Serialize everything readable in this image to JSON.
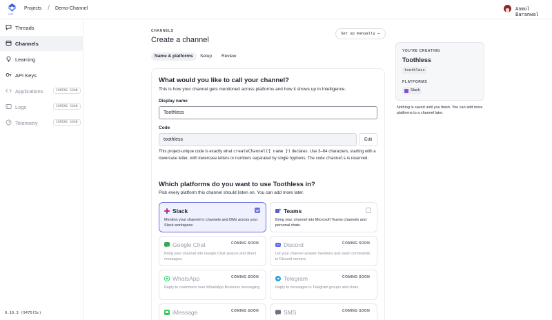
{
  "topbar": {
    "breadcrumbs": [
      "Projects",
      "Demo-Channel"
    ],
    "separator": "/",
    "user_name": "Anmol Baranwal"
  },
  "sidebar": {
    "items": [
      {
        "label": "Threads",
        "icon": "chat-bubble-icon",
        "state": "normal"
      },
      {
        "label": "Channels",
        "icon": "channels-icon",
        "state": "active"
      },
      {
        "label": "Learning",
        "icon": "lightbulb-icon",
        "state": "normal"
      },
      {
        "label": "API Keys",
        "icon": "key-icon",
        "state": "normal"
      },
      {
        "label": "Applications",
        "icon": "code-icon",
        "state": "soon",
        "badge": "COMING SOON"
      },
      {
        "label": "Logs",
        "icon": "terminal-icon",
        "state": "soon",
        "badge": "COMING SOON"
      },
      {
        "label": "Telemetry",
        "icon": "telemetry-icon",
        "state": "soon",
        "badge": "COMING SOON"
      }
    ],
    "version": "0.10.3 (9475f3c)"
  },
  "header": {
    "eyebrow": "CHANNELS",
    "title": "Create a channel",
    "manual_button": "Set up manually →",
    "tabs": [
      "Name & platforms",
      "Setup",
      "Review"
    ],
    "active_tab": "Name & platforms"
  },
  "form": {
    "title": "What would you like to call your channel?",
    "subtitle": "This is how your channel gets mentioned across platforms and how it shows up in Intelligence.",
    "display_name_label": "Display name",
    "display_name_value": "Toothless",
    "code_label": "Code",
    "code_value": "toothless",
    "edit_button": "Edit",
    "help_part1": "This project-unique code is exactly what ",
    "help_code1": "createChannel({ name })",
    "help_part2": " declares. Use 3–64 characters, starting with a lowercase letter, with lowercase letters or numbers separated by single hyphens. The code ",
    "help_code2": "channels",
    "help_part3": " is reserved."
  },
  "platforms_section": {
    "title": "Which platforms do you want to use Toothless in?",
    "subtitle": "Pick every platform this channel should listen on. You can add more later.",
    "coming_soon": "COMING SOON",
    "items": [
      {
        "name": "Slack",
        "desc": "Mention your channel in channels and DMs across your Slack workspace.",
        "selected": true,
        "available": true,
        "icon": "slack-icon",
        "color": "#7b3fc4"
      },
      {
        "name": "Teams",
        "desc": "Bring your channel into Microsoft Teams channels and personal chats.",
        "selected": false,
        "available": true,
        "icon": "teams-icon",
        "color": "#5b5fc7"
      },
      {
        "name": "Google Chat",
        "desc": "Bring your channel into Google Chat spaces and direct messages.",
        "selected": false,
        "available": false,
        "icon": "google-chat-icon",
        "color": "#34a853"
      },
      {
        "name": "Discord",
        "desc": "Let your channel answer mentions and slash commands in Discord servers.",
        "selected": false,
        "available": false,
        "icon": "discord-icon",
        "color": "#5865f2"
      },
      {
        "name": "WhatsApp",
        "desc": "Reply to customers over WhatsApp Business messaging.",
        "selected": false,
        "available": false,
        "icon": "whatsapp-icon",
        "color": "#25d366"
      },
      {
        "name": "Telegram",
        "desc": "Reply to messages in Telegram groups and chats.",
        "selected": false,
        "available": false,
        "icon": "telegram-icon",
        "color": "#2aa1de"
      },
      {
        "name": "iMessage",
        "desc": "",
        "selected": false,
        "available": false,
        "icon": "imessage-icon",
        "color": "#34c759"
      },
      {
        "name": "SMS",
        "desc": "",
        "selected": false,
        "available": false,
        "icon": "sms-icon",
        "color": "#6b6f7d"
      }
    ]
  },
  "summary": {
    "eyebrow": "YOU'RE CREATING",
    "name": "Toothless",
    "code": "toothless",
    "platforms_label": "PLATFORMS",
    "platform_pill": "Slack",
    "note": "Nothing is saved until you finish. You can add more platforms to a channel later."
  }
}
